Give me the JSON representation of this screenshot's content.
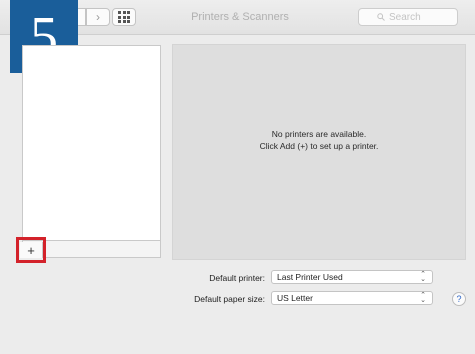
{
  "window": {
    "title": "Printers & Scanners"
  },
  "toolbar": {
    "back_glyph": "‹",
    "forward_glyph": "›",
    "search_placeholder": "Search",
    "search_icon": "magnifier-icon"
  },
  "step": {
    "number": "5"
  },
  "printer_list": {
    "items": [],
    "add_label": "+",
    "highlight_color": "#d3222a"
  },
  "detail": {
    "line1": "No printers are available.",
    "line2": "Click Add (+) to set up a printer."
  },
  "settings": {
    "default_printer_label": "Default printer:",
    "default_printer_value": "Last Printer Used",
    "paper_size_label": "Default paper size:",
    "paper_size_value": "US Letter"
  },
  "help": {
    "label": "?"
  },
  "colors": {
    "badge": "#1a5e9a",
    "highlight": "#d3222a",
    "help": "#2b64c6"
  }
}
